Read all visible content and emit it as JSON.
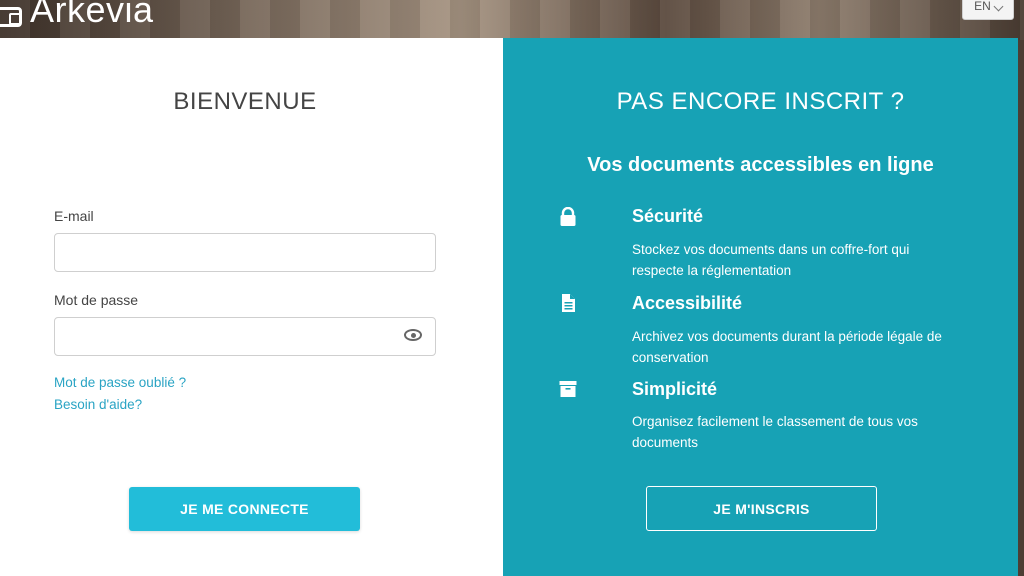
{
  "brand": {
    "name": "Arkevia",
    "icon": "archive-box-icon"
  },
  "language": {
    "selected": "EN"
  },
  "login": {
    "title": "BIENVENUE",
    "email_label": "E-mail",
    "email_value": "",
    "password_label": "Mot de passe",
    "password_value": "",
    "forgot_password": "Mot de passe oublié ?",
    "help": "Besoin d'aide?",
    "submit": "JE ME CONNECTE"
  },
  "signup": {
    "title": "PAS ENCORE INSCRIT ?",
    "subtitle": "Vos documents accessibles en ligne",
    "features": [
      {
        "icon": "lock-icon",
        "title": "Sécurité",
        "desc": "Stockez vos documents dans un coffre-fort qui respecte la réglementation"
      },
      {
        "icon": "document-icon",
        "title": "Accessibilité",
        "desc": "Archivez vos documents durant la période légale de conservation"
      },
      {
        "icon": "archive-icon",
        "title": "Simplicité",
        "desc": "Organisez facilement le classement de tous vos documents"
      }
    ],
    "submit": "JE M'INSCRIS"
  },
  "colors": {
    "accent": "#17a2b5",
    "button": "#22bdd9",
    "link": "#2aa4c4"
  }
}
